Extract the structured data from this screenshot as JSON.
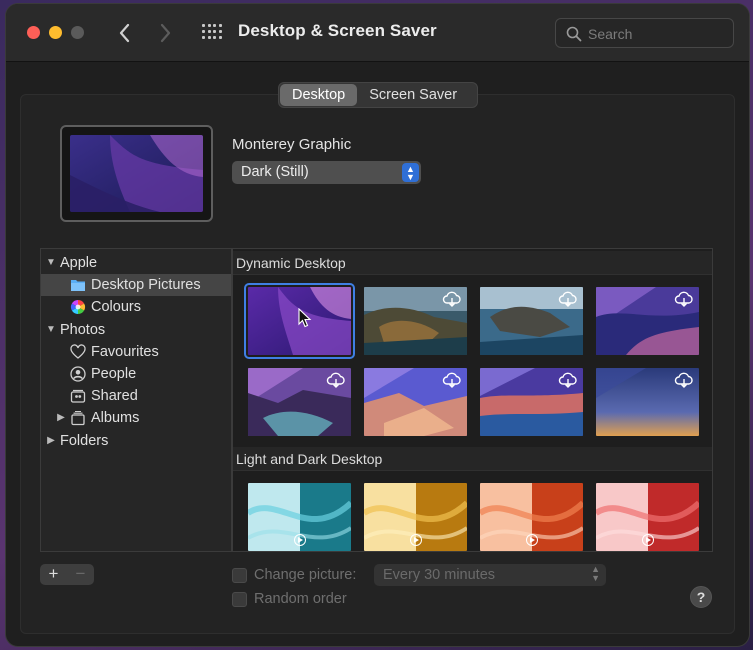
{
  "window": {
    "title": "Desktop & Screen Saver",
    "search_placeholder": "Search"
  },
  "tabs": [
    {
      "label": "Desktop",
      "active": true
    },
    {
      "label": "Screen Saver",
      "active": false
    }
  ],
  "current": {
    "name": "Monterey Graphic",
    "appearance": "Dark (Still)"
  },
  "sidebar": {
    "groups": [
      {
        "label": "Apple",
        "expanded": true,
        "items": [
          {
            "label": "Desktop Pictures",
            "icon": "folder-icon",
            "selected": true
          },
          {
            "label": "Colours",
            "icon": "color-wheel-icon",
            "selected": false
          }
        ]
      },
      {
        "label": "Photos",
        "expanded": true,
        "items": [
          {
            "label": "Favourites",
            "icon": "heart-icon"
          },
          {
            "label": "People",
            "icon": "person-icon"
          },
          {
            "label": "Shared",
            "icon": "shared-album-icon"
          },
          {
            "label": "Albums",
            "icon": "album-stack-icon",
            "collapsed": true
          }
        ]
      },
      {
        "label": "Folders",
        "expanded": false,
        "items": []
      }
    ]
  },
  "gallery": {
    "sections": [
      {
        "title": "Dynamic Desktop"
      },
      {
        "title": "Light and Dark Desktop"
      }
    ]
  },
  "bottom": {
    "add_label": "+",
    "remove_label": "−",
    "change_picture_label": "Change picture:",
    "interval_value": "Every 30 minutes",
    "random_order_label": "Random order",
    "help_label": "?"
  },
  "colors": {
    "accent": "#2f6fd6",
    "close": "#fe5f57",
    "minimize": "#febc2e"
  }
}
